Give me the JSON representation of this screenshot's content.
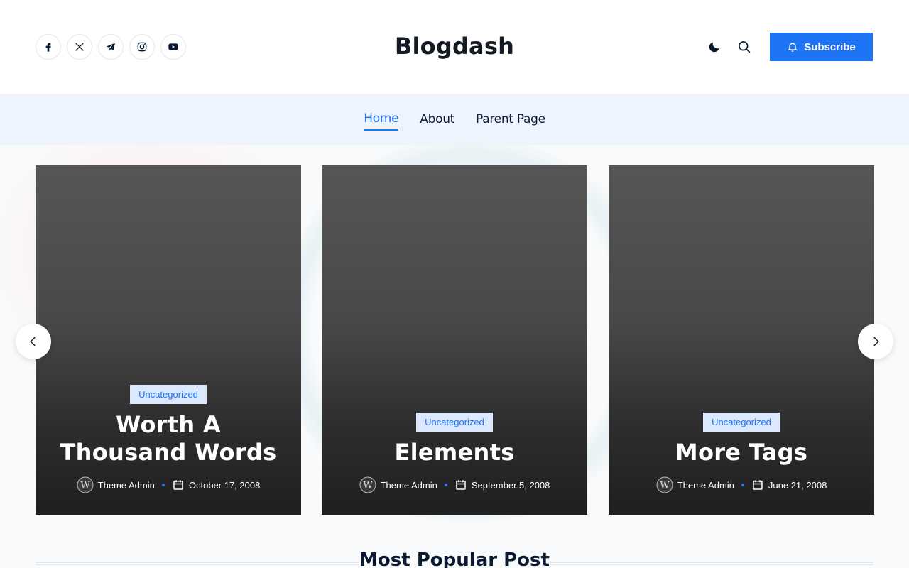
{
  "header": {
    "site_title": "Blogdash",
    "socials": [
      {
        "name": "facebook-icon"
      },
      {
        "name": "x-icon"
      },
      {
        "name": "telegram-icon"
      },
      {
        "name": "instagram-icon"
      },
      {
        "name": "youtube-icon"
      }
    ],
    "subscribe_label": "Subscribe"
  },
  "nav": {
    "items": [
      {
        "label": "Home",
        "active": true
      },
      {
        "label": "About",
        "active": false
      },
      {
        "label": "Parent Page",
        "active": false
      }
    ]
  },
  "slider": {
    "cards": [
      {
        "category": "Uncategorized",
        "title": "Worth A Thousand Words",
        "author": "Theme Admin",
        "date": "October 17, 2008"
      },
      {
        "category": "Uncategorized",
        "title": "Elements",
        "author": "Theme Admin",
        "date": "September 5, 2008"
      },
      {
        "category": "Uncategorized",
        "title": "More Tags",
        "author": "Theme Admin",
        "date": "June 21, 2008"
      }
    ]
  },
  "popular": {
    "title": "Most Popular Post"
  },
  "colors": {
    "accent": "#1d74f5",
    "nav_bg": "#eef4fe",
    "badge_bg": "#dbe8fd"
  }
}
